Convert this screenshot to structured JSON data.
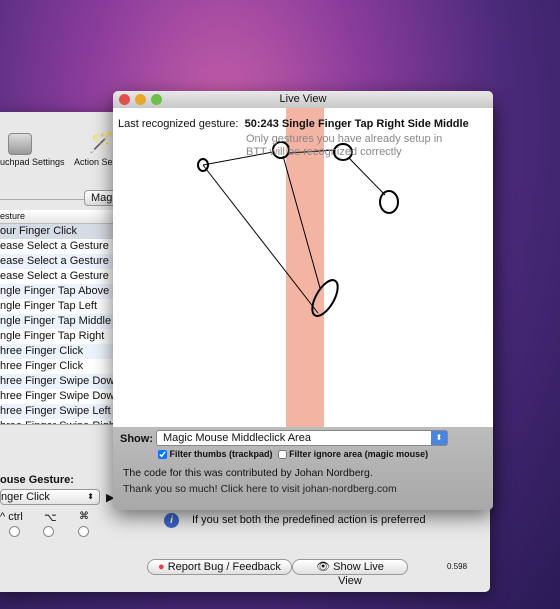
{
  "main_window": {
    "toolbar": [
      {
        "label": "uchpad Settings",
        "icon": "trackpad-icon"
      },
      {
        "label": "Action Se",
        "icon": "magic-wand-icon"
      }
    ],
    "segment_label": "Mag",
    "table": {
      "header": "esture",
      "rows": [
        "our Finger Click",
        "ease Select a Gesture",
        "ease Select a Gesture",
        "ease Select a Gesture",
        "ngle Finger Tap Above",
        "ngle Finger Tap Left",
        "ngle Finger Tap Middle",
        "ngle Finger Tap Right",
        "hree Finger Click",
        "hree Finger Click",
        "hree Finger Swipe Dow",
        "hree Finger Swipe Dow",
        "hree Finger Swipe Left",
        "hree Finger Swipe Righ"
      ]
    },
    "gesture_label": "ouse Gesture:",
    "gesture_popup": "nger Click",
    "modifiers": [
      "^ ctrl",
      "⌥",
      "⌘"
    ],
    "info_text": "If you set both the predefined action is preferred",
    "report_bug": "Report Bug / Feedback",
    "show_live_view": "Show Live View",
    "version": "0.598"
  },
  "live_view": {
    "title": "Live View",
    "last_label": "Last recognized gesture:",
    "last_value": "50:243 Single Finger Tap Right Side Middle",
    "hint1": "Only gestures you have already setup in",
    "hint2": "BTT will be recognized correctly",
    "show_label": "Show:",
    "show_value": "Magic Mouse Middleclick Area",
    "filter_thumbs": "Filter thumbs (trackpad)",
    "filter_thumbs_checked": true,
    "filter_ignore": "Filter ignore area (magic mouse)",
    "filter_ignore_checked": false,
    "credit1": "The code for this was contributed by Johan Nordberg.",
    "credit2": "Thank you so much! Click here to visit johan-nordberg.com",
    "zone_color": "#f4b4a4"
  }
}
